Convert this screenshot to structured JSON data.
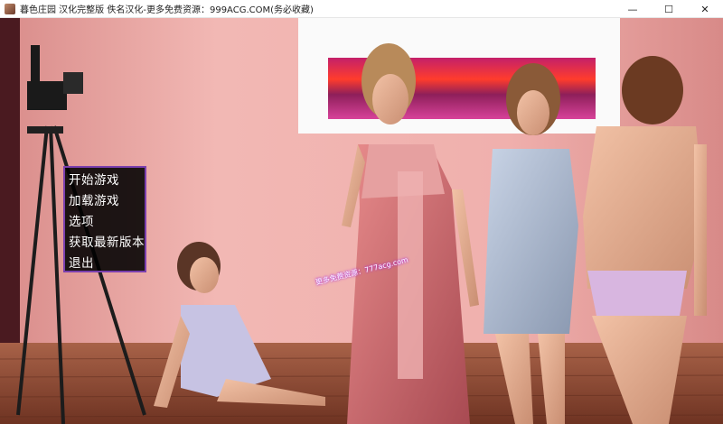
{
  "window": {
    "title": "暮色庄园 汉化完整版 佚名汉化-更多免费资源：999ACG.COM(务必收藏)",
    "controls": {
      "minimize": "—",
      "maximize": "☐",
      "close": "✕"
    }
  },
  "menu": {
    "items": [
      {
        "label": "开始游戏"
      },
      {
        "label": "加载游戏"
      },
      {
        "label": "选项"
      },
      {
        "label": "获取最新版本"
      },
      {
        "label": "退出"
      }
    ]
  },
  "watermark": {
    "text": "更多免费资源：777acg.com"
  },
  "colors": {
    "menu_border": "#7a3fae",
    "menu_bg": "#000000",
    "wall": "#e9a6a6",
    "floor": "#8a4a34"
  }
}
